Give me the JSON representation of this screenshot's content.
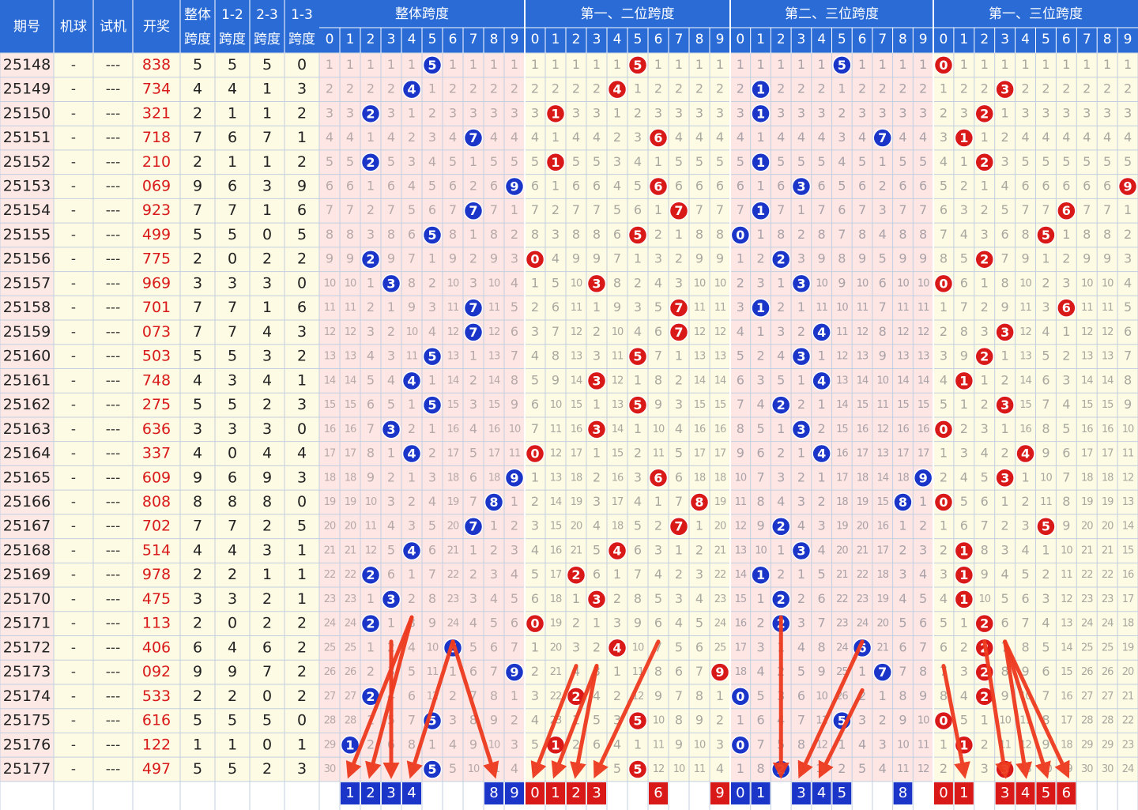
{
  "header": {
    "issue": "期号",
    "machine": "机球",
    "test": "试机",
    "draw": "开奖",
    "span_all_l1": "整体",
    "span_all_l2": "跨度",
    "span_12_l1": "1-2",
    "span_12_l2": "跨度",
    "span_23_l1": "2-3",
    "span_23_l2": "跨度",
    "span_13_l1": "1-3",
    "span_13_l2": "跨度",
    "group_overall": "整体跨度",
    "group_12": "第一、二位跨度",
    "group_23": "第二、三位跨度",
    "group_13": "第一、三位跨度"
  },
  "digits": [
    "0",
    "1",
    "2",
    "3",
    "4",
    "5",
    "6",
    "7",
    "8",
    "9"
  ],
  "colors": {
    "blue_ball": "#1a35c8",
    "red_ball": "#d91818",
    "header_bg": "#2a6bd6",
    "pink_bg": "#fde6e4",
    "cream_bg": "#fdfbe3",
    "draw_text": "#d81a1a",
    "arrow": "#ee3a1e"
  },
  "chart_data": {
    "type": "table",
    "rows": [
      {
        "issue": "25148",
        "machine": "-",
        "test": "---",
        "draw": "838",
        "span": 5,
        "s12": 5,
        "s23": 5,
        "s13": 0
      },
      {
        "issue": "25149",
        "machine": "-",
        "test": "---",
        "draw": "734",
        "span": 4,
        "s12": 4,
        "s23": 1,
        "s13": 3
      },
      {
        "issue": "25150",
        "machine": "-",
        "test": "---",
        "draw": "321",
        "span": 2,
        "s12": 1,
        "s23": 1,
        "s13": 2
      },
      {
        "issue": "25151",
        "machine": "-",
        "test": "---",
        "draw": "718",
        "span": 7,
        "s12": 6,
        "s23": 7,
        "s13": 1
      },
      {
        "issue": "25152",
        "machine": "-",
        "test": "---",
        "draw": "210",
        "span": 2,
        "s12": 1,
        "s23": 1,
        "s13": 2
      },
      {
        "issue": "25153",
        "machine": "-",
        "test": "---",
        "draw": "069",
        "span": 9,
        "s12": 6,
        "s23": 3,
        "s13": 9
      },
      {
        "issue": "25154",
        "machine": "-",
        "test": "---",
        "draw": "923",
        "span": 7,
        "s12": 7,
        "s23": 1,
        "s13": 6
      },
      {
        "issue": "25155",
        "machine": "-",
        "test": "---",
        "draw": "499",
        "span": 5,
        "s12": 5,
        "s23": 0,
        "s13": 5
      },
      {
        "issue": "25156",
        "machine": "-",
        "test": "---",
        "draw": "775",
        "span": 2,
        "s12": 0,
        "s23": 2,
        "s13": 2
      },
      {
        "issue": "25157",
        "machine": "-",
        "test": "---",
        "draw": "969",
        "span": 3,
        "s12": 3,
        "s23": 3,
        "s13": 0
      },
      {
        "issue": "25158",
        "machine": "-",
        "test": "---",
        "draw": "701",
        "span": 7,
        "s12": 7,
        "s23": 1,
        "s13": 6
      },
      {
        "issue": "25159",
        "machine": "-",
        "test": "---",
        "draw": "073",
        "span": 7,
        "s12": 7,
        "s23": 4,
        "s13": 3
      },
      {
        "issue": "25160",
        "machine": "-",
        "test": "---",
        "draw": "503",
        "span": 5,
        "s12": 5,
        "s23": 3,
        "s13": 2
      },
      {
        "issue": "25161",
        "machine": "-",
        "test": "---",
        "draw": "748",
        "span": 4,
        "s12": 3,
        "s23": 4,
        "s13": 1
      },
      {
        "issue": "25162",
        "machine": "-",
        "test": "---",
        "draw": "275",
        "span": 5,
        "s12": 5,
        "s23": 2,
        "s13": 3
      },
      {
        "issue": "25163",
        "machine": "-",
        "test": "---",
        "draw": "636",
        "span": 3,
        "s12": 3,
        "s23": 3,
        "s13": 0
      },
      {
        "issue": "25164",
        "machine": "-",
        "test": "---",
        "draw": "337",
        "span": 4,
        "s12": 0,
        "s23": 4,
        "s13": 4
      },
      {
        "issue": "25165",
        "machine": "-",
        "test": "---",
        "draw": "609",
        "span": 9,
        "s12": 6,
        "s23": 9,
        "s13": 3
      },
      {
        "issue": "25166",
        "machine": "-",
        "test": "---",
        "draw": "808",
        "span": 8,
        "s12": 8,
        "s23": 8,
        "s13": 0
      },
      {
        "issue": "25167",
        "machine": "-",
        "test": "---",
        "draw": "702",
        "span": 7,
        "s12": 7,
        "s23": 2,
        "s13": 5
      },
      {
        "issue": "25168",
        "machine": "-",
        "test": "---",
        "draw": "514",
        "span": 4,
        "s12": 4,
        "s23": 3,
        "s13": 1
      },
      {
        "issue": "25169",
        "machine": "-",
        "test": "---",
        "draw": "978",
        "span": 2,
        "s12": 2,
        "s23": 1,
        "s13": 1
      },
      {
        "issue": "25170",
        "machine": "-",
        "test": "---",
        "draw": "475",
        "span": 3,
        "s12": 3,
        "s23": 2,
        "s13": 1
      },
      {
        "issue": "25171",
        "machine": "-",
        "test": "---",
        "draw": "113",
        "span": 2,
        "s12": 0,
        "s23": 2,
        "s13": 2
      },
      {
        "issue": "25172",
        "machine": "-",
        "test": "---",
        "draw": "406",
        "span": 6,
        "s12": 4,
        "s23": 6,
        "s13": 2
      },
      {
        "issue": "25173",
        "machine": "-",
        "test": "---",
        "draw": "092",
        "span": 9,
        "s12": 9,
        "s23": 7,
        "s13": 2
      },
      {
        "issue": "25174",
        "machine": "-",
        "test": "---",
        "draw": "533",
        "span": 2,
        "s12": 2,
        "s23": 0,
        "s13": 2
      },
      {
        "issue": "25175",
        "machine": "-",
        "test": "---",
        "draw": "616",
        "span": 5,
        "s12": 5,
        "s23": 5,
        "s13": 0
      },
      {
        "issue": "25176",
        "machine": "-",
        "test": "---",
        "draw": "122",
        "span": 1,
        "s12": 1,
        "s23": 0,
        "s13": 1
      },
      {
        "issue": "25177",
        "machine": "-",
        "test": "---",
        "draw": "497",
        "span": 5,
        "s12": 5,
        "s23": 2,
        "s13": 3
      }
    ],
    "picks": {
      "overall": [
        "1",
        "2",
        "3",
        "4",
        "8",
        "9"
      ],
      "pos12": [
        "0",
        "1",
        "2",
        "3",
        "6",
        "9"
      ],
      "pos23": [
        "0",
        "1",
        "3",
        "4",
        "5",
        "8"
      ],
      "pos13": [
        "0",
        "1",
        "3",
        "4",
        "5",
        "6"
      ]
    },
    "arrows": {
      "overall": [
        {
          "from_issue": "25171",
          "from_digit": 4,
          "to_digit": 1
        },
        {
          "from_issue": "25171",
          "from_digit": 4,
          "to_digit": 2
        },
        {
          "from_issue": "25172",
          "from_digit": 3,
          "to_digit": 3
        },
        {
          "from_issue": "25172",
          "from_digit": 6,
          "to_digit": 4
        },
        {
          "from_issue": "25172",
          "from_digit": 6,
          "to_digit": 8
        }
      ],
      "pos12": [
        {
          "from_issue": "25173",
          "from_digit": 2,
          "to_digit": 0
        },
        {
          "from_issue": "25173",
          "from_digit": 3,
          "to_digit": 1
        },
        {
          "from_issue": "25173",
          "from_digit": 3,
          "to_digit": 2
        },
        {
          "from_issue": "25172",
          "from_digit": 6,
          "to_digit": 3
        }
      ],
      "pos23": [
        {
          "from_issue": "25171",
          "from_digit": 2,
          "to_digit": 2
        },
        {
          "from_issue": "25172",
          "from_digit": 6,
          "to_digit": 3
        },
        {
          "from_issue": "25174",
          "from_digit": 6,
          "to_digit": 4
        }
      ],
      "pos13": [
        {
          "from_issue": "25173",
          "from_digit": 0,
          "to_digit": 1
        },
        {
          "from_issue": "25172",
          "from_digit": 2,
          "to_digit": 3
        },
        {
          "from_issue": "25172",
          "from_digit": 3,
          "to_digit": 4
        },
        {
          "from_issue": "25172",
          "from_digit": 3,
          "to_digit": 5
        },
        {
          "from_issue": "25172",
          "from_digit": 3,
          "to_digit": 6
        }
      ]
    }
  }
}
